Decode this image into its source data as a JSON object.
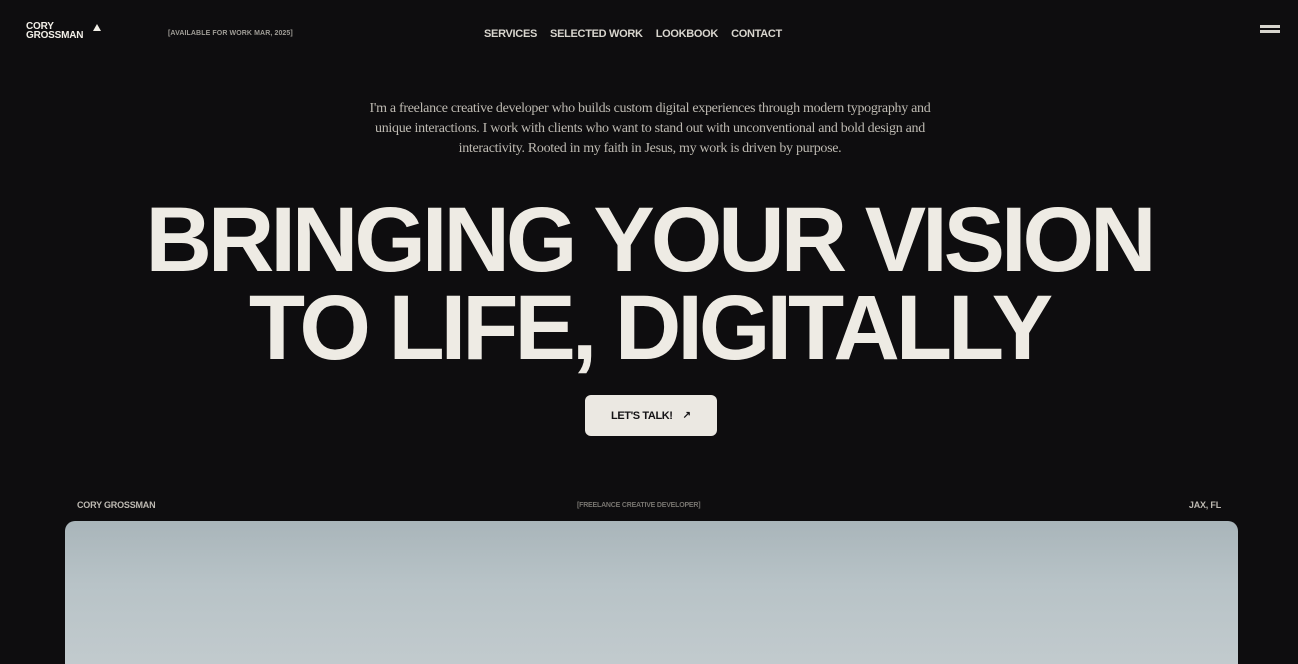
{
  "header": {
    "logo_line1": "CORY",
    "logo_line2": "GROSSMAN",
    "availability": "[AVAILABLE FOR WORK MAR, 2025]",
    "nav": [
      {
        "label": "SERVICES"
      },
      {
        "label": "SELECTED WORK"
      },
      {
        "label": "LOOKBOOK"
      },
      {
        "label": "CONTACT"
      }
    ]
  },
  "intro": {
    "text": "I'm a freelance creative developer who builds custom digital experiences through modern typography and unique interactions. I work with clients who want to stand out with unconventional and bold design and interactivity. Rooted in my faith in Jesus, my work is driven by purpose."
  },
  "hero": {
    "line1": "BRINGING YOUR VISION",
    "line2": "TO LIFE, DIGITALLY"
  },
  "cta": {
    "label": "LET'S TALK!",
    "arrow": "↗"
  },
  "meta": {
    "left": "CORY GROSSMAN",
    "center": "[FREELANCE CREATIVE DEVELOPER]",
    "right": "JAX, FL"
  },
  "colors": {
    "background": "#0e0d0f",
    "text": "#eeebe4",
    "cta_bg": "#ebe8e2"
  }
}
